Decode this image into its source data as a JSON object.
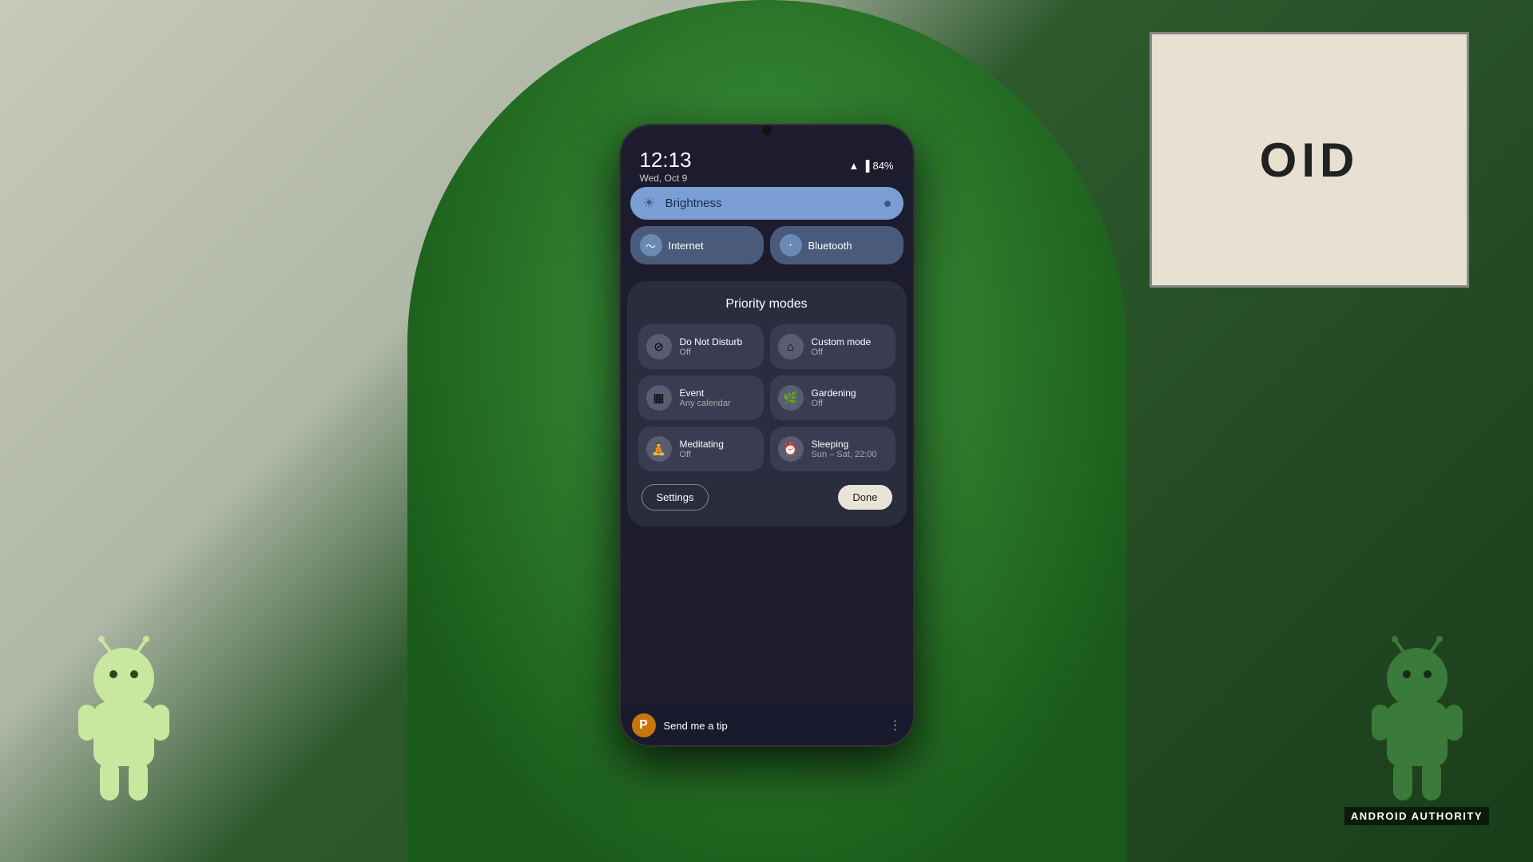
{
  "scene": {
    "watermark": "ANDROID AUTHORITY"
  },
  "phone": {
    "status_bar": {
      "time": "12:13",
      "date": "Wed, Oct 9",
      "battery": "84%",
      "wifi_icon": "📶",
      "battery_icon": "🔋"
    },
    "brightness": {
      "label": "Brightness",
      "icon": "☀"
    },
    "tiles": [
      {
        "label": "Internet",
        "icon": "🌐"
      },
      {
        "label": "Bluetooth",
        "icon": "🔵"
      }
    ],
    "priority_modes": {
      "title": "Priority modes",
      "modes": [
        {
          "name": "Do Not Disturb",
          "status": "Off",
          "icon": "⊘"
        },
        {
          "name": "Custom mode",
          "status": "Off",
          "icon": "🏠"
        },
        {
          "name": "Event",
          "status": "Any calendar",
          "icon": "📅"
        },
        {
          "name": "Gardening",
          "status": "Off",
          "icon": "🌿"
        },
        {
          "name": "Meditating",
          "status": "Off",
          "icon": "🧘"
        },
        {
          "name": "Sleeping",
          "status": "Sun – Sat, 22:00",
          "icon": "⏰"
        }
      ],
      "settings_btn": "Settings",
      "done_btn": "Done"
    },
    "tip_bar": {
      "text": "Send me a tip",
      "icon": "P"
    }
  }
}
